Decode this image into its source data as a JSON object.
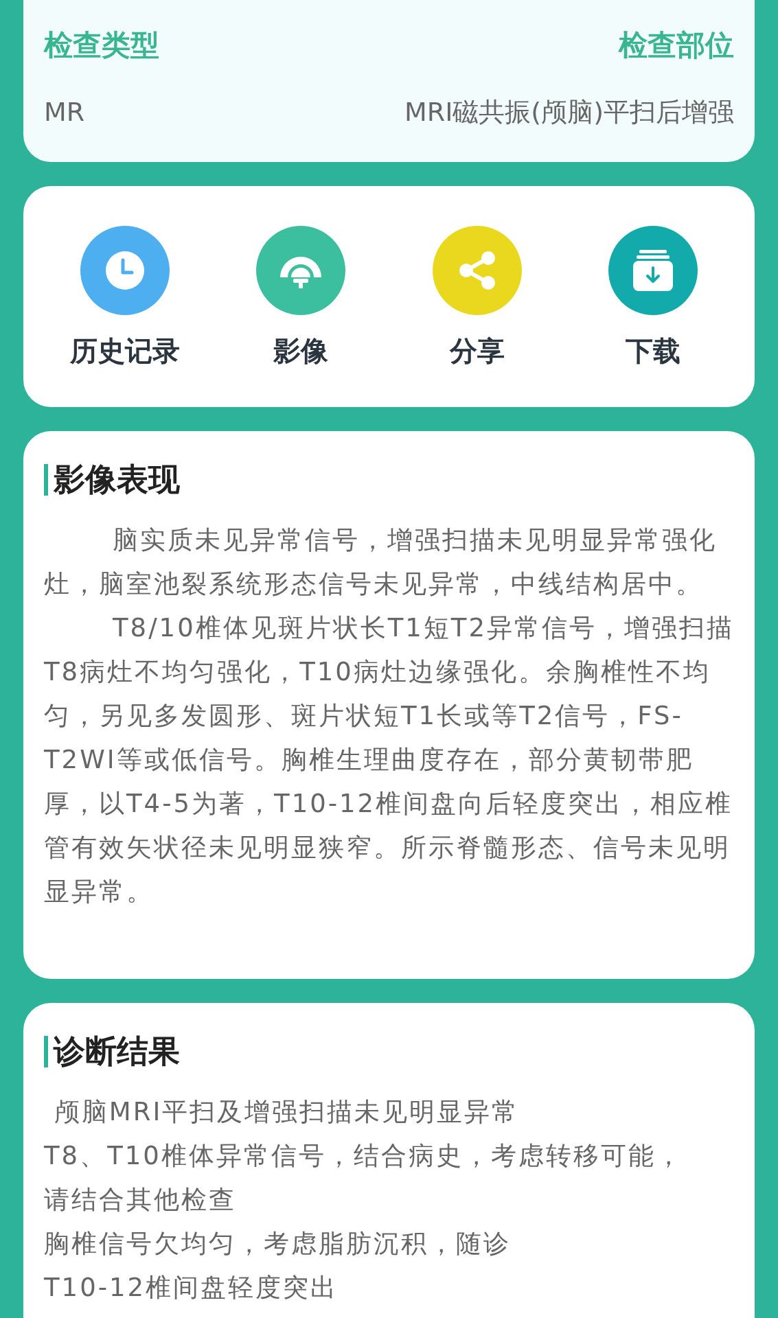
{
  "exam_info": {
    "type_label": "检查类型",
    "part_label": "检查部位",
    "type_value": "MR",
    "part_value": "MRI磁共振(颅脑)平扫后增强"
  },
  "actions": [
    {
      "kind": "history",
      "label": "历史记录",
      "color": "#4daef0"
    },
    {
      "kind": "image",
      "label": "影像",
      "color": "#3bbf9e"
    },
    {
      "kind": "share",
      "label": "分享",
      "color": "#ead81f"
    },
    {
      "kind": "download",
      "label": "下载",
      "color": "#12aaaa"
    }
  ],
  "findings": {
    "title": "影像表现",
    "paragraphs": [
      "脑实质未见异常信号，增强扫描未见明显异常强化灶，脑室池裂系统形态信号未见异常，中线结构居中。",
      "T8/10椎体见斑片状长T1短T2异常信号，增强扫描T8病灶不均匀强化，T10病灶边缘强化。余胸椎性不均匀，另见多发圆形、斑片状短T1长或等T2信号，FS-T2WI等或低信号。胸椎生理曲度存在，部分黄韧带肥厚，以T4-5为著，T10-12椎间盘向后轻度突出，相应椎管有效矢状径未见明显狭窄。所示脊髓形态、信号未见明显异常。"
    ]
  },
  "diagnosis": {
    "title": "诊断结果",
    "lines": [
      " 颅脑MRI平扫及增强扫描未见明显异常",
      "T8、T10椎体异常信号，结合病史，考虑转移可能，请结合其他检查",
      "胸椎信号欠均匀，考虑脂肪沉积，随诊",
      "T10-12椎间盘轻度突出"
    ]
  }
}
